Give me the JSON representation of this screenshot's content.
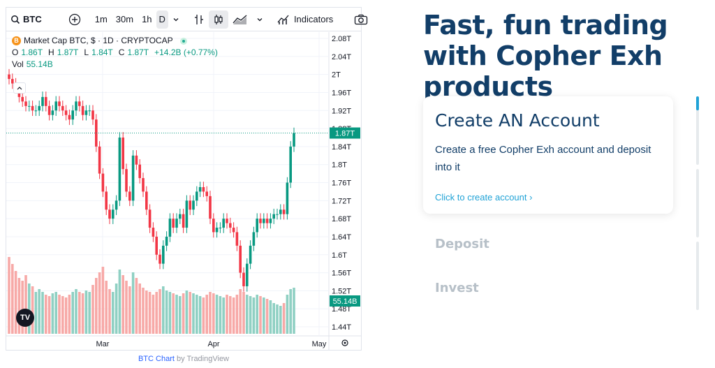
{
  "toolbar": {
    "symbol": "BTC",
    "intervals": [
      "1m",
      "30m",
      "1h",
      "D"
    ],
    "active_interval": "D",
    "indicators_label": "Indicators"
  },
  "legend": {
    "title": "Market Cap BTC, $ · 1D · CRYPTOCAP",
    "coin_glyph": "B",
    "ohlc": {
      "o_key": "O",
      "o": "1.86T",
      "h_key": "H",
      "h": "1.87T",
      "l_key": "L",
      "l": "1.84T",
      "c_key": "C",
      "c": "1.87T",
      "change": "+14.2B (+0.77%)"
    },
    "vol_label": "Vol",
    "vol_value": "55.14B"
  },
  "colors": {
    "up": "#089981",
    "down": "#f23645",
    "up_vol": "#8fd0c3",
    "down_vol": "#f7a9a7",
    "accent": "#1fa2d6",
    "brand": "#123e68"
  },
  "chart_data": {
    "type": "candlestick",
    "yticks": [
      "2.08T",
      "2.04T",
      "2T",
      "1.96T",
      "1.92T",
      "1.88T",
      "1.84T",
      "1.8T",
      "1.76T",
      "1.72T",
      "1.68T",
      "1.64T",
      "1.6T",
      "1.56T",
      "1.52T",
      "1.48T",
      "1.44T"
    ],
    "ylim": [
      1.44,
      2.08
    ],
    "xticks": [
      "Mar",
      "Apr",
      "May"
    ],
    "price_badge": "1.87T",
    "volume_badge": "55.14B",
    "last_price": 1.87,
    "close": [
      1.99,
      1.98,
      1.97,
      1.95,
      1.94,
      1.93,
      1.93,
      1.92,
      1.92,
      1.93,
      1.95,
      1.93,
      1.91,
      1.92,
      1.94,
      1.93,
      1.92,
      1.91,
      1.9,
      1.92,
      1.94,
      1.93,
      1.91,
      1.92,
      1.92,
      1.9,
      1.84,
      1.78,
      1.74,
      1.7,
      1.68,
      1.7,
      1.72,
      1.86,
      1.79,
      1.74,
      1.72,
      1.82,
      1.8,
      1.77,
      1.74,
      1.7,
      1.66,
      1.64,
      1.6,
      1.58,
      1.62,
      1.64,
      1.68,
      1.66,
      1.68,
      1.69,
      1.66,
      1.72,
      1.7,
      1.72,
      1.74,
      1.75,
      1.74,
      1.73,
      1.68,
      1.65,
      1.66,
      1.66,
      1.68,
      1.67,
      1.66,
      1.65,
      1.62,
      1.56,
      1.53,
      1.58,
      1.62,
      1.65,
      1.68,
      1.67,
      1.68,
      1.67,
      1.68,
      1.69,
      1.69,
      1.7,
      1.69,
      1.76,
      1.84,
      1.87
    ],
    "volume": [
      55,
      50,
      45,
      40,
      38,
      42,
      36,
      34,
      30,
      32,
      30,
      28,
      27,
      29,
      30,
      28,
      27,
      26,
      28,
      30,
      32,
      30,
      29,
      31,
      30,
      35,
      40,
      44,
      48,
      38,
      32,
      30,
      36,
      46,
      42,
      38,
      34,
      44,
      40,
      36,
      33,
      31,
      30,
      28,
      30,
      32,
      34,
      31,
      30,
      29,
      28,
      27,
      29,
      31,
      30,
      29,
      28,
      27,
      26,
      28,
      30,
      29,
      28,
      27,
      26,
      28,
      27,
      26,
      28,
      32,
      30,
      28,
      27,
      26,
      28,
      27,
      26,
      25,
      24,
      22,
      21,
      20,
      22,
      28,
      32,
      33
    ]
  },
  "attribution": {
    "link": "BTC Chart",
    "by": " by TradingView"
  },
  "tv_logo": "TV",
  "headline": "Fast, fun trading with Copher Exh products",
  "card": {
    "title": "Create AN Account",
    "description": "Create a free Copher Exh account and deposit into it",
    "link": "Click to create account ›"
  },
  "steps": [
    "Deposit",
    "Invest"
  ],
  "progress": {
    "active_step": 1,
    "total_steps": 3
  }
}
